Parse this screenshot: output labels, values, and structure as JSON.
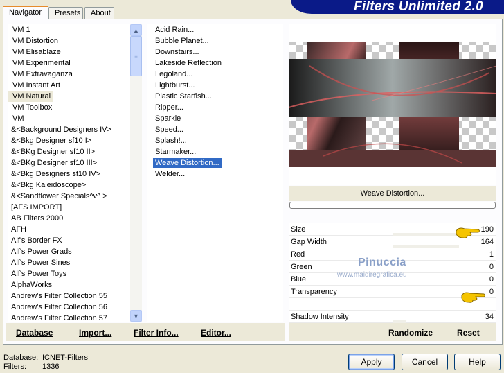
{
  "app": {
    "title": "Filters Unlimited 2.0"
  },
  "tabs": [
    {
      "label": "Navigator"
    },
    {
      "label": "Presets"
    },
    {
      "label": "About"
    }
  ],
  "categories": {
    "selected": "VM Natural",
    "items": [
      "VM 1",
      "VM Distortion",
      "VM Elisablaze",
      "VM Experimental",
      "VM Extravaganza",
      "VM Instant Art",
      "VM Natural",
      "VM Toolbox",
      "VM",
      "&<Background Designers IV>",
      "&<Bkg Designer sf10 I>",
      "&<BKg Designer sf10 II>",
      "&<BKg Designer sf10 III>",
      "&<Bkg Designers sf10 IV>",
      "&<Bkg Kaleidoscope>",
      "&<Sandflower Specials^v^ >",
      "[AFS IMPORT]",
      "AB Filters 2000",
      "AFH",
      "Alf's Border FX",
      "Alf's Power Grads",
      "Alf's Power Sines",
      "Alf's Power Toys",
      "AlphaWorks",
      "Andrew's Filter Collection 55",
      "Andrew's Filter Collection 56",
      "Andrew's Filter Collection 57"
    ]
  },
  "filters": {
    "selected": "Weave Distortion...",
    "items": [
      "Acid Rain...",
      "Bubble Planet...",
      "Downstairs...",
      "Lakeside Reflection",
      "Legoland...",
      "Lightburst...",
      "Plastic Starfish...",
      "Ripper...",
      "Sparkle",
      "Speed...",
      "Splash!...",
      "Starmaker...",
      "Weave Distortion...",
      "Welder..."
    ]
  },
  "left_buttons": {
    "database": "Database",
    "import": "Import...",
    "filter_info": "Filter Info...",
    "editor": "Editor..."
  },
  "preview": {
    "filter_name": "Weave Distortion..."
  },
  "params": [
    {
      "label": "Size",
      "value": "190",
      "level": 0.745
    },
    {
      "label": "Gap Width",
      "value": "164",
      "level": 0.643
    },
    {
      "label": "Red",
      "value": "1",
      "level": 0
    },
    {
      "label": "Green",
      "value": "0",
      "level": 0
    },
    {
      "label": "Blue",
      "value": "0",
      "level": 0
    },
    {
      "label": "Transparency",
      "value": "0",
      "level": 0
    },
    {
      "label": "",
      "value": "",
      "level": 0
    },
    {
      "label": "Shadow Intensity",
      "value": "34",
      "level": 0.133
    }
  ],
  "watermark": {
    "name": "Pinuccia",
    "url": "www.maidiregrafica.eu"
  },
  "right_buttons": {
    "randomize": "Randomize",
    "reset": "Reset"
  },
  "footer": {
    "database_label": "Database:",
    "database_value": "ICNET-Filters",
    "filters_label": "Filters:",
    "filters_value": "1336"
  },
  "dialog_buttons": {
    "apply": "Apply",
    "cancel": "Cancel",
    "help": "Help"
  },
  "colors": {
    "banner": "#0a1a88",
    "selection": "#316ac5",
    "pointer": "#f5c400"
  }
}
